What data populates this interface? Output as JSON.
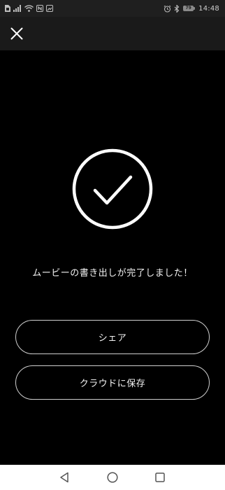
{
  "status_bar": {
    "time": "14:48",
    "battery_level": "79",
    "left_icons": [
      "sim-icon",
      "signal-icon",
      "wifi-icon",
      "nfc-icon",
      "photo-notification-icon"
    ],
    "right_icons": [
      "alarm-icon",
      "bluetooth-icon"
    ]
  },
  "app_bar": {
    "close_icon": "close-icon"
  },
  "main": {
    "success_icon": "check-circle-icon",
    "message": "ムービーの書き出しが完了しました！",
    "share_label": "シェア",
    "cloud_save_label": "クラウドに保存"
  },
  "nav_bar": {
    "icons": [
      "back-icon",
      "home-icon",
      "recent-apps-icon"
    ]
  },
  "colors": {
    "background": "#000000",
    "status_bar": "#1f1f1f",
    "app_bar": "#1a1a1a",
    "foreground": "#ffffff",
    "button_border": "#cfcfcf",
    "nav_bar": "#ffffff"
  }
}
